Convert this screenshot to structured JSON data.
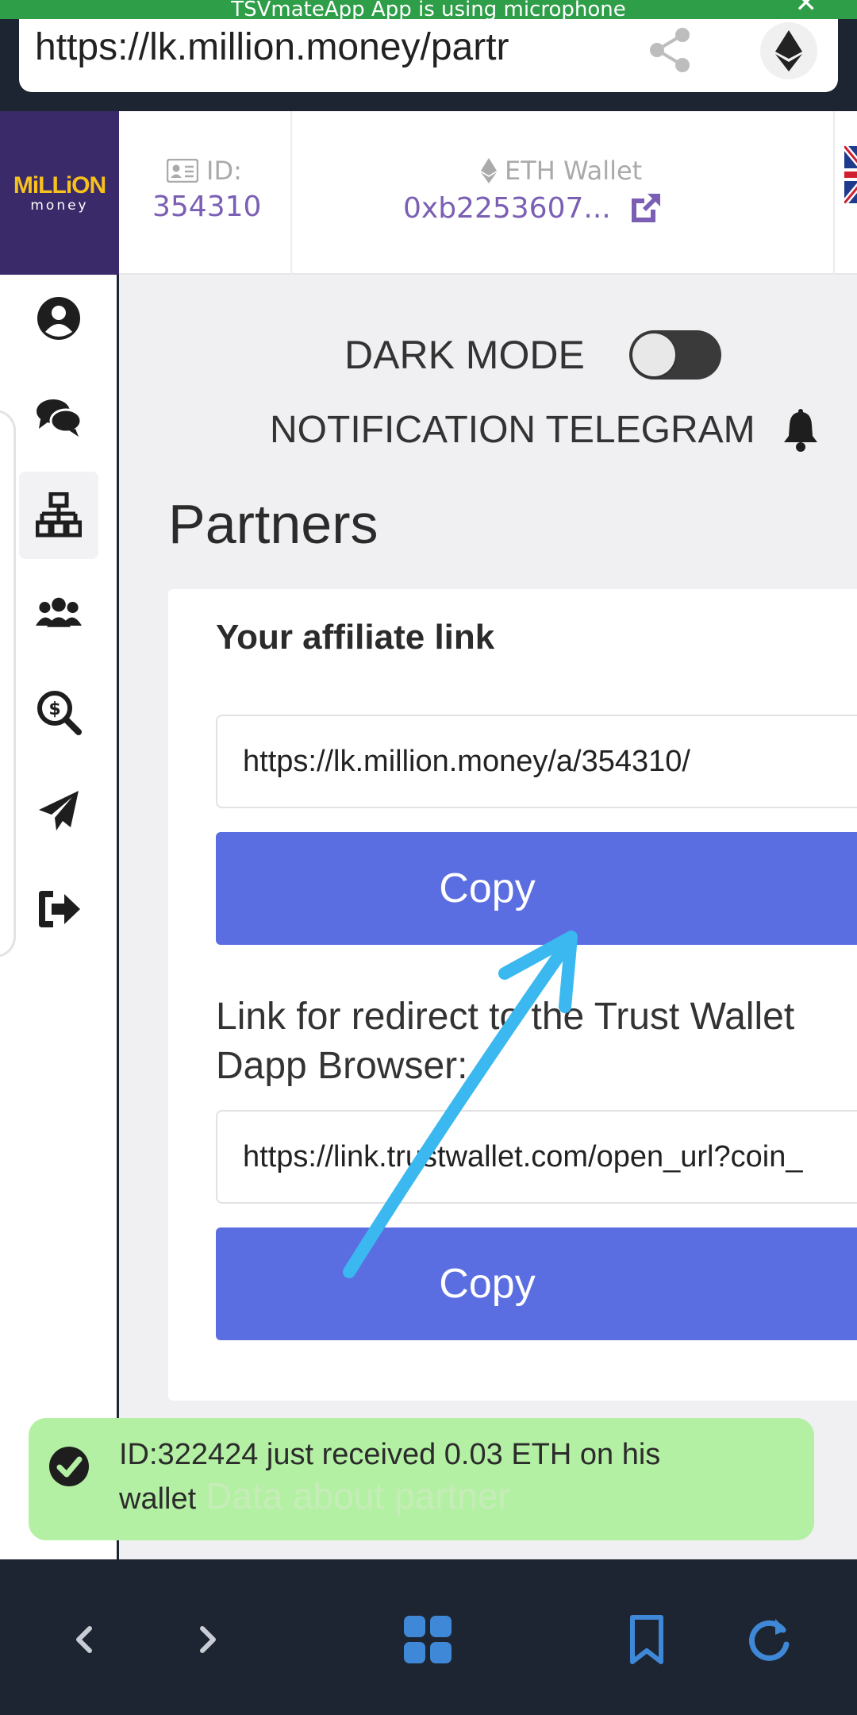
{
  "status": {
    "text": "TSVmateApp App is using microphone",
    "close_glyph": "✕"
  },
  "browser": {
    "url": "https://lk.million.money/partr",
    "share_icon": "share-icon",
    "eth_icon": "ethereum-icon"
  },
  "header": {
    "logo_top": "MiLLiON",
    "logo_bottom": "money",
    "id_label": "ID:",
    "id_value": "354310",
    "wallet_label": "ETH Wallet",
    "wallet_value": "0xb2253607...",
    "wallet_link_icon": "external-link-icon",
    "flag_icon": "uk-flag-icon"
  },
  "sidebar": {
    "items": [
      {
        "icon": "user-icon"
      },
      {
        "icon": "chat-icon"
      },
      {
        "icon": "sitemap-icon",
        "active": true
      },
      {
        "icon": "users-icon"
      },
      {
        "icon": "search-dollar-icon"
      },
      {
        "icon": "paper-plane-icon"
      },
      {
        "icon": "sign-out-icon"
      }
    ]
  },
  "settings": {
    "dark_mode_label": "DARK MODE",
    "dark_mode_on": false,
    "notification_label": "NOTIFICATION TELEGRAM"
  },
  "page": {
    "title": "Partners",
    "affiliate_title": "Your affiliate link",
    "affiliate_link": "https://lk.million.money/a/354310/",
    "copy_label_1": "Copy",
    "redirect_label": "Link for redirect to the Trust Wallet Dapp Browser:",
    "trust_link": "https://link.trustwallet.com/open_url?coin_",
    "copy_label_2": "Copy"
  },
  "toast": {
    "message": "ID:322424 just received 0.03 ETH on his wallet",
    "behind_text": "Data about partner"
  },
  "colors": {
    "accent": "#5b6ee1",
    "id_value": "#7a5fb4",
    "logo_bg": "#3b2a6a",
    "toast_bg": "#b4f0a4",
    "arrow": "#3ab8ef",
    "browser_bar": "#1e2532",
    "nav_icons": "#3f88d8"
  },
  "bottom_nav": {
    "items": [
      "back-icon",
      "forward-icon",
      "tabs-grid-icon",
      "bookmark-icon",
      "refresh-icon"
    ]
  }
}
